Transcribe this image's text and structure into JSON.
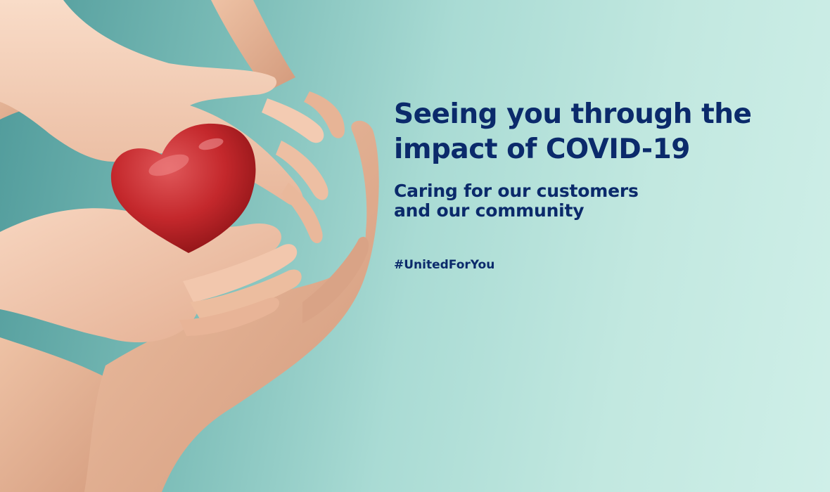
{
  "banner": {
    "headline_line1": "Seeing you through the",
    "headline_line2": "impact of COVID-19",
    "subhead_line1": "Caring for our customers",
    "subhead_line2": "and our community",
    "hashtag": "#UnitedForYou"
  },
  "colors": {
    "text": "#0b2a6b",
    "background_left": "#4f9a9a",
    "background_right": "#cfefe8",
    "heart": "#c8282c",
    "skin": "#f0c6ac"
  },
  "image": {
    "subject": "hands-holding-red-heart-icon"
  }
}
